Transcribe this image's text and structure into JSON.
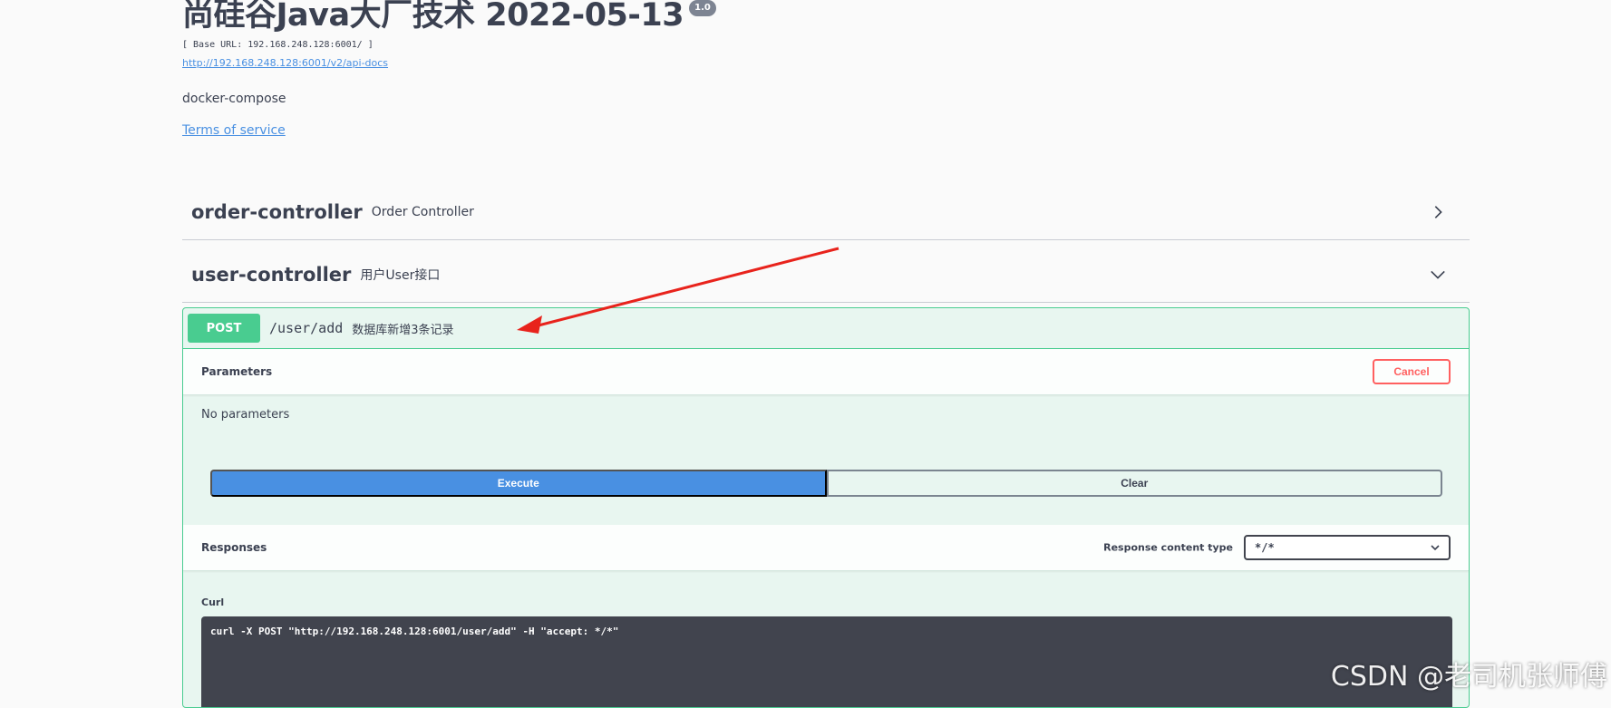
{
  "info": {
    "title": "尚硅谷Java大厂技术 2022-05-13",
    "version": "1.0",
    "base_url": "[ Base URL: 192.168.248.128:6001/ ]",
    "api_docs_link": "http://192.168.248.128:6001/v2/api-docs",
    "description": "docker-compose",
    "terms_of_service": "Terms of service"
  },
  "tags": [
    {
      "name": "order-controller",
      "description": "Order Controller",
      "state": "collapsed",
      "icon": "chevron-right-icon"
    },
    {
      "name": "user-controller",
      "description": "用户User接口",
      "state": "expanded",
      "icon": "chevron-down-icon"
    }
  ],
  "operation": {
    "method": "POST",
    "path": "/user/add",
    "summary": "数据库新增3条记录",
    "parameters_title": "Parameters",
    "cancel_label": "Cancel",
    "no_parameters": "No parameters",
    "execute_label": "Execute",
    "clear_label": "Clear",
    "responses_title": "Responses",
    "response_content_type_label": "Response content type",
    "response_content_type_value": "*/*",
    "curl_label": "Curl",
    "curl_command": "curl -X POST \"http://192.168.248.128:6001/user/add\" -H \"accept: */*\""
  },
  "watermark": "CSDN @老司机张师傅",
  "colors": {
    "post": "#49cc90",
    "execute": "#4990e2",
    "cancel": "#ff6060",
    "link": "#4990e2",
    "curl_bg": "#41444e",
    "annotation_arrow": "#e8231c"
  }
}
